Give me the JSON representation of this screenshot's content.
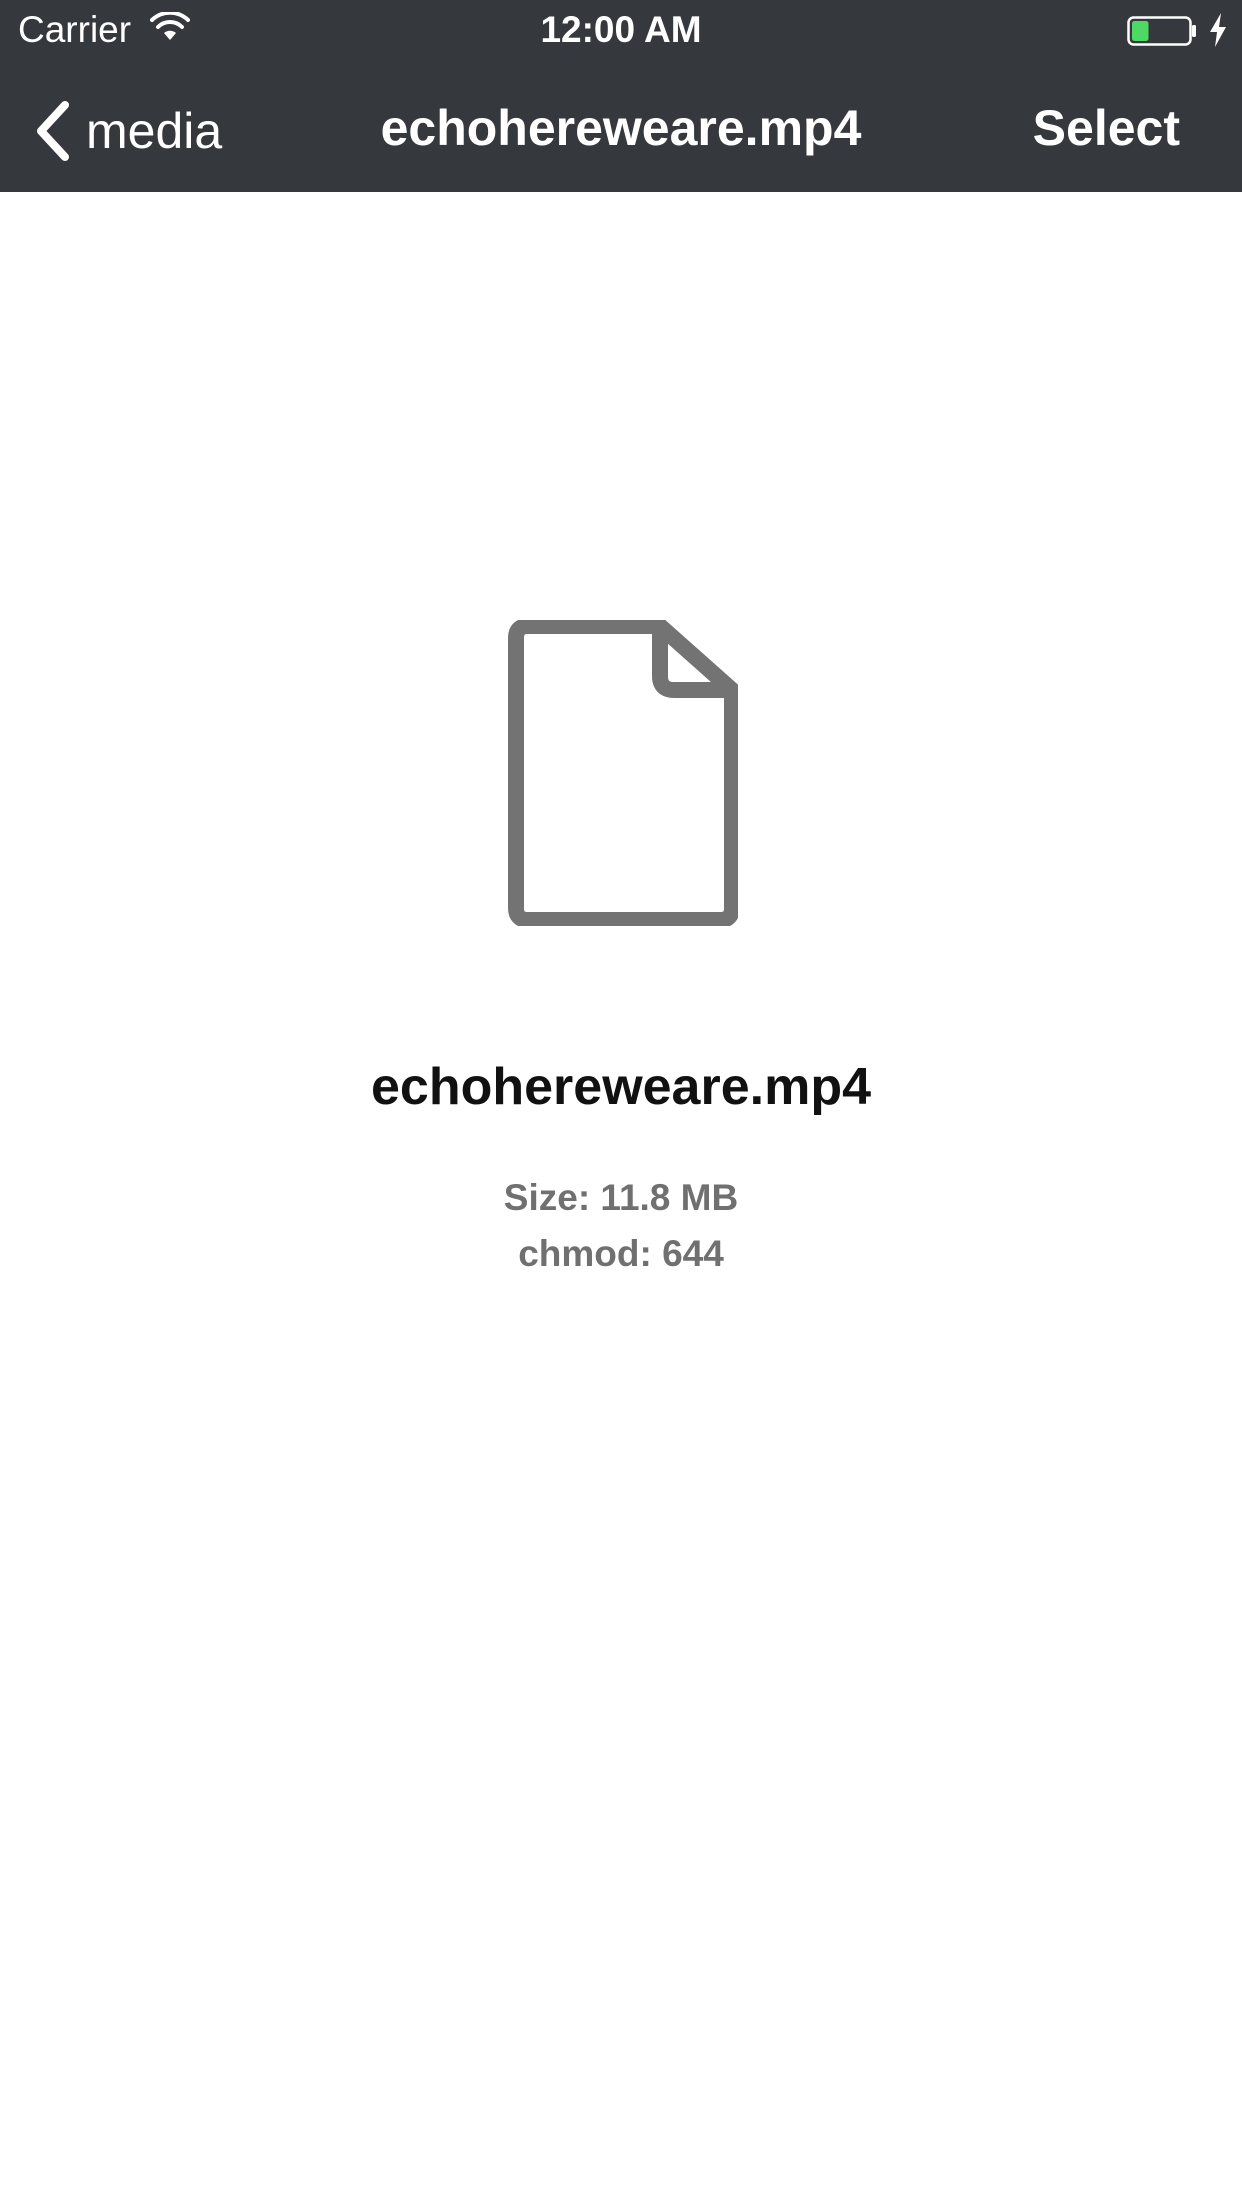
{
  "status_bar": {
    "carrier": "Carrier",
    "time": "12:00 AM",
    "battery_level": 0.3,
    "icons": [
      "wifi-icon",
      "battery-icon",
      "charging-bolt-icon"
    ]
  },
  "nav_bar": {
    "back_label": "media",
    "title": "echohereweare.mp4",
    "select_label": "Select",
    "icons": [
      "chevron-left-icon"
    ]
  },
  "file": {
    "icon": "document-icon",
    "name": "echohereweare.mp4",
    "size_text": "Size: 11.8 MB",
    "chmod_text": "chmod: 644"
  },
  "colors": {
    "bar_background": "#35383d",
    "bar_text": "#ffffff",
    "icon_gray": "#737373",
    "meta_text": "#707070",
    "battery_green": "#4cd964"
  }
}
